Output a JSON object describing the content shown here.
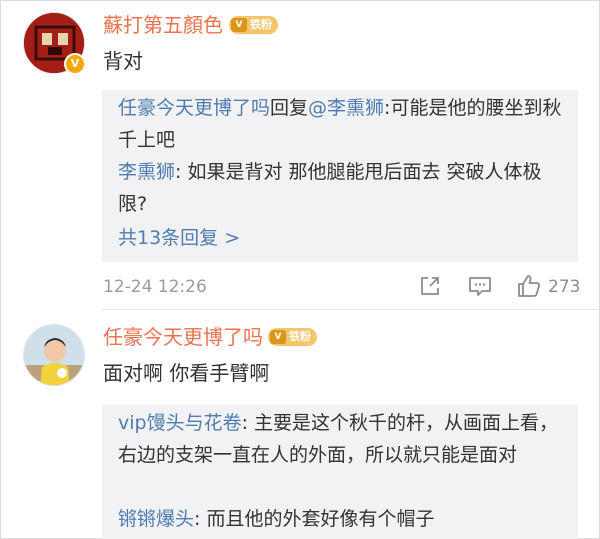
{
  "comments": [
    {
      "username": "蘇打第五顏色",
      "badge": "铁粉",
      "text": "背对",
      "replies": [
        {
          "author": "任豪今天更博了吗",
          "mid": "回复",
          "mention": "@李熏狮",
          "text": ":可能是他的腰坐到秋千上吧"
        },
        {
          "author": "李熏狮",
          "text": ": 如果是背对 那他腿能甩后面去 突破人体极限?"
        }
      ],
      "more_replies": "共13条回复 >",
      "time": "12-24 12:26",
      "likes": "273"
    },
    {
      "username": "任豪今天更博了吗",
      "badge": "铁粉",
      "text": "面对啊  你看手臂啊",
      "replies": [
        {
          "author": "vip馒头与花卷",
          "text": ": 主要是这个秋千的杆，从画面上看，右边的支架一直在人的外面，所以就只能是面对"
        },
        {
          "author": "锵锵爆头",
          "text": ": 而且他的外套好像有个帽子"
        }
      ]
    }
  ],
  "icons": {
    "share": "share-icon",
    "comment": "comment-icon",
    "like": "thumbs-up-icon",
    "verified": "verified-badge-icon",
    "fan_badge": "fan-badge-icon"
  },
  "colors": {
    "username": "#eb7350",
    "link": "#4e7cb0",
    "reply_bg": "#f2f2f5",
    "meta": "#9b9b9b"
  }
}
